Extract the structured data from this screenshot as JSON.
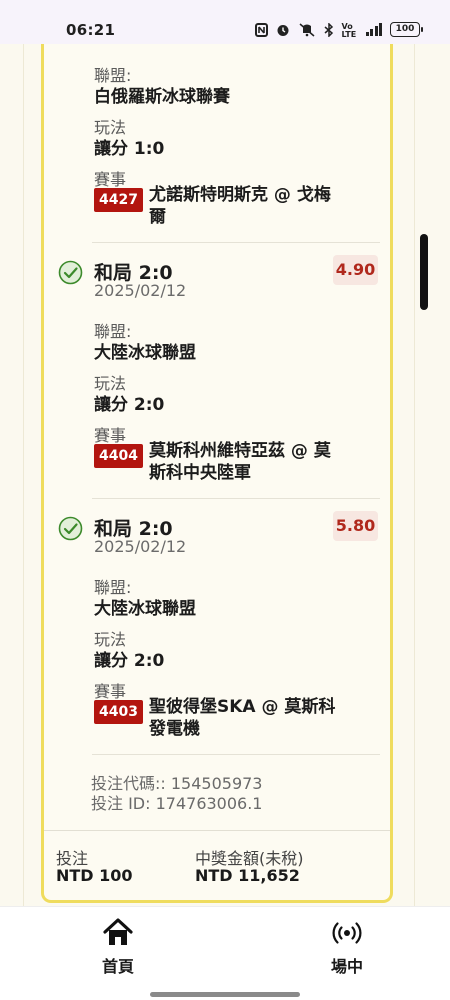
{
  "status_bar": {
    "time": "06:21",
    "network_label": "Vo LTE",
    "cell_label": "4G",
    "battery": "100",
    "icons": [
      "nfc-icon",
      "alarm-icon",
      "vibrate-icon",
      "bluetooth-icon",
      "volte-icon",
      "signal-icon",
      "battery-icon"
    ]
  },
  "labels": {
    "league": "聯盟:",
    "play": "玩法",
    "match": "賽事"
  },
  "top_partial": {
    "league": "白俄羅斯冰球聯賽",
    "play": "讓分 1:0",
    "match_code": "4427",
    "match_name": "尤諾斯特明斯克 @ 戈梅爾"
  },
  "bets": [
    {
      "title": "和局 2:0",
      "date": "2025/02/12",
      "odds": "4.90",
      "league": "大陸冰球聯盟",
      "play": "讓分 2:0",
      "match_code": "4404",
      "match_name": "莫斯科州維特亞茲 @ 莫斯科中央陸軍"
    },
    {
      "title": "和局 2:0",
      "date": "2025/02/12",
      "odds": "5.80",
      "league": "大陸冰球聯盟",
      "play": "讓分 2:0",
      "match_code": "4403",
      "match_name": "聖彼得堡SKA @ 莫斯科發電機"
    }
  ],
  "refs": {
    "bet_code": "投注代碼:: 154505973",
    "bet_id": "投注 ID: 174763006.1"
  },
  "summary": {
    "stake_label": "投注",
    "stake_value": "NTD 100",
    "payout_label": "中獎金額(未稅)",
    "payout_value": "NTD 11,652"
  },
  "nav": {
    "home_label": "首頁",
    "live_label": "場中"
  },
  "colors": {
    "accent_border": "#efdc5d",
    "badge": "#b3150f",
    "odds_text": "#b0281c",
    "check": "#3c8a2b"
  }
}
